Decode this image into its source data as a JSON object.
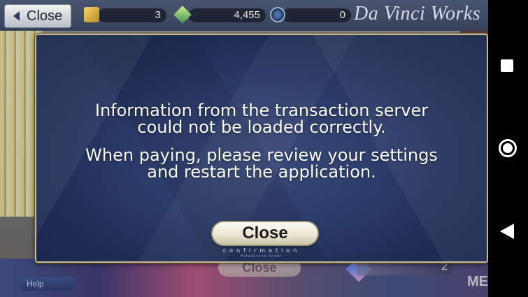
{
  "topbar": {
    "close_label": "Close",
    "currency1": {
      "icon": "gold-box-icon",
      "value": "3"
    },
    "currency2": {
      "icon": "green-gem-icon",
      "value": "4,455"
    },
    "currency3": {
      "icon": "blue-medal-icon",
      "value": "0"
    },
    "shop_title": "Da Vinci Works"
  },
  "dialog": {
    "message_line1": "Information from the transaction server",
    "message_line2": "could not be loaded correctly.",
    "message_line3": "When paying, please review your settings",
    "message_line4": "and restart the application.",
    "close_label": "Close",
    "confirm_label": "confirmation",
    "brand_label": "Fate/Grand Order"
  },
  "background": {
    "close_label": "Close",
    "count_value": "2",
    "help_label": "Help",
    "me_text": "ME"
  },
  "navbar": {
    "recents": "square-icon",
    "home": "circle-icon",
    "back": "triangle-back-icon"
  },
  "colors": {
    "dialog_bg": "#2d3d6c",
    "dialog_border": "#c8b88a",
    "button_bg": "#ece7d4",
    "text": "#ffffff"
  }
}
